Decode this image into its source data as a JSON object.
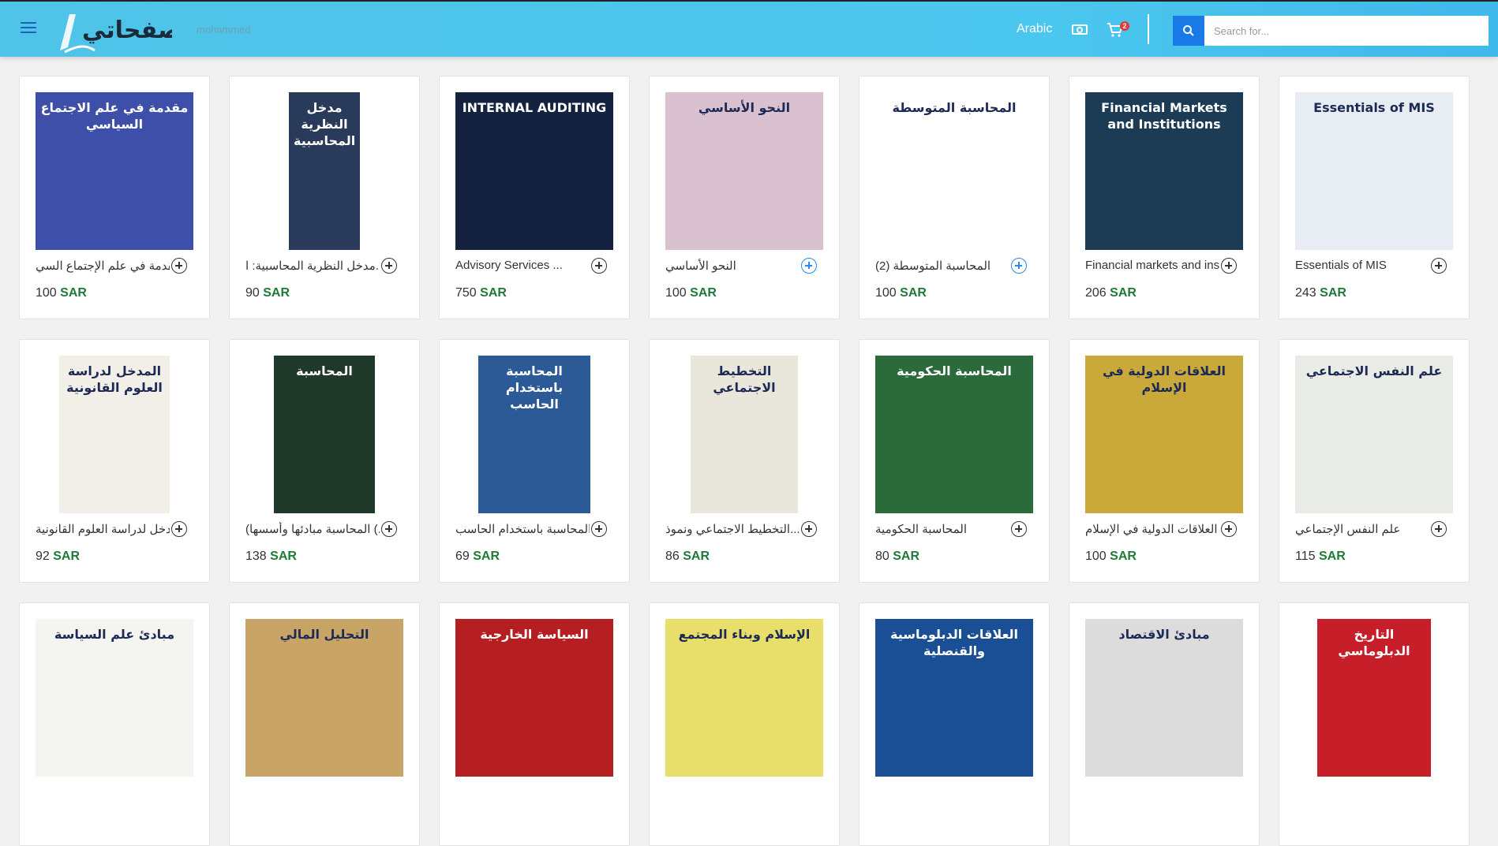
{
  "header": {
    "username": "mohammed",
    "language": "Arabic",
    "cart_count": "2",
    "search_placeholder": "Search for..."
  },
  "currency": "SAR",
  "products": [
    {
      "title": "مقدمة في علم الإجتماع السي...",
      "price": "100",
      "cover_text": "مقدمة في علم الاجتماع السياسي",
      "cover_bg": "#3d4fa8",
      "add_style": "dark"
    },
    {
      "title": "مدخل النظرية المحاسبية: ا...",
      "price": "90",
      "cover_text": "مدخل النظرية المحاسبية",
      "cover_bg": "#2a3a5a",
      "add_style": "dark"
    },
    {
      "title": "Advisory Services ...",
      "price": "750",
      "cover_text": "INTERNAL AUDITING",
      "cover_bg": "#14213f",
      "add_style": "dark"
    },
    {
      "title": "النحو الأساسي",
      "price": "100",
      "cover_text": "النحو الأساسي",
      "cover_bg": "#d9c1cf",
      "add_style": "blue"
    },
    {
      "title": "المحاسبة المتوسطة (2)",
      "price": "100",
      "cover_text": "المحاسبة المتوسطة",
      "cover_bg": "#ffffff",
      "add_style": "blue"
    },
    {
      "title": "Financial markets and institutions",
      "price": "206",
      "cover_text": "Financial Markets and Institutions",
      "cover_bg": "#1c3c55",
      "add_style": "dark"
    },
    {
      "title": "Essentials of MIS",
      "price": "243",
      "cover_text": "Essentials of MIS",
      "cover_bg": "#e8edf3",
      "add_style": "dark"
    },
    {
      "title": "المدخل لدراسة العلوم القانونية",
      "price": "92",
      "cover_text": "المدخل لدراسة العلوم القانونية",
      "cover_bg": "#f2efe8",
      "add_style": "dark"
    },
    {
      "title": "(المحاسبة مبادئها وأسسها (...",
      "price": "138",
      "cover_text": "المحاسبة",
      "cover_bg": "#1f3a2a",
      "add_style": "dark"
    },
    {
      "title": "المحاسبة باستخدام الحاسب ...",
      "price": "69",
      "cover_text": "المحاسبة باستخدام الحاسب",
      "cover_bg": "#2c5a96",
      "add_style": "dark"
    },
    {
      "title": "التخطيط الاجتماعي ونموذ...",
      "price": "86",
      "cover_text": "التخطيط الاجتماعي",
      "cover_bg": "#e9e6dc",
      "add_style": "dark"
    },
    {
      "title": "المحاسبة الحكومية",
      "price": "80",
      "cover_text": "المحاسبة الحكومية",
      "cover_bg": "#2b6a3a",
      "add_style": "dark"
    },
    {
      "title": "العلاقات الدولية في الإسلام",
      "price": "100",
      "cover_text": "العلاقات الدولية في الإسلام",
      "cover_bg": "#c9a93a",
      "add_style": "dark"
    },
    {
      "title": "علم النفس الإجتماعي",
      "price": "115",
      "cover_text": "علم النفس الاجتماعي",
      "cover_bg": "#e9ebe6",
      "add_style": "dark"
    },
    {
      "title": "",
      "price": "",
      "cover_text": "مبادئ علم السياسة",
      "cover_bg": "#f4f4f0",
      "add_style": "dark"
    },
    {
      "title": "",
      "price": "",
      "cover_text": "التحليل المالي",
      "cover_bg": "#c8a466",
      "add_style": "dark"
    },
    {
      "title": "",
      "price": "",
      "cover_text": "السياسة الخارجية",
      "cover_bg": "#b61f22",
      "add_style": "dark"
    },
    {
      "title": "",
      "price": "",
      "cover_text": "الإسلام وبناء المجتمع",
      "cover_bg": "#e8df6a",
      "add_style": "dark"
    },
    {
      "title": "",
      "price": "",
      "cover_text": "العلاقات الدبلوماسية والقنصلية",
      "cover_bg": "#1a4f96",
      "add_style": "dark"
    },
    {
      "title": "",
      "price": "",
      "cover_text": "مبادئ الاقتصاد",
      "cover_bg": "#dcdcdc",
      "add_style": "dark"
    },
    {
      "title": "",
      "price": "",
      "cover_text": "التاريخ الدبلوماسي",
      "cover_bg": "#c61f2a",
      "add_style": "dark"
    }
  ]
}
